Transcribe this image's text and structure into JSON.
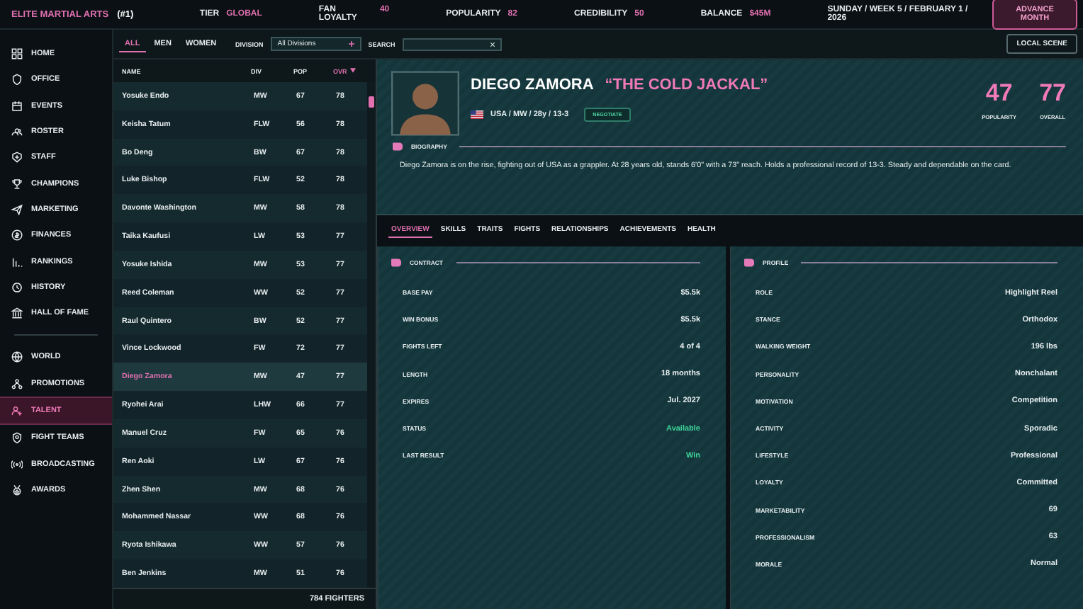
{
  "top_bar": {
    "title": "ELITE MARTIAL ARTS",
    "rank": "(#1)",
    "stats": [
      {
        "label": "TIER",
        "value": "GLOBAL"
      },
      {
        "label": "FAN LOYALTY",
        "value": "40"
      },
      {
        "label": "POPULARITY",
        "value": "82"
      },
      {
        "label": "CREDIBILITY",
        "value": "50"
      },
      {
        "label": "BALANCE",
        "value": "$45M"
      }
    ],
    "date": "SUNDAY / WEEK 5 / FEBRUARY 1 / 2026",
    "button": "ADVANCE MONTH"
  },
  "sidebar": {
    "groups": [
      [
        {
          "label": "HOME",
          "selected": false
        },
        {
          "label": "OFFICE",
          "selected": false
        },
        {
          "label": "EVENTS",
          "selected": false
        },
        {
          "label": "ROSTER",
          "selected": false
        },
        {
          "label": "STAFF",
          "selected": false
        },
        {
          "label": "CHAMPIONS",
          "selected": false
        },
        {
          "label": "MARKETING",
          "selected": false
        },
        {
          "label": "FINANCES",
          "selected": false
        },
        {
          "label": "RANKINGS",
          "selected": false
        },
        {
          "label": "HISTORY",
          "selected": false
        },
        {
          "label": "HALL OF FAME",
          "selected": false
        }
      ],
      [
        {
          "label": "WORLD",
          "selected": false
        },
        {
          "label": "PROMOTIONS",
          "selected": false
        },
        {
          "label": "TALENT",
          "selected": true
        },
        {
          "label": "FIGHT TEAMS",
          "selected": false
        },
        {
          "label": "BROADCASTING",
          "selected": false
        },
        {
          "label": "AWARDS",
          "selected": false
        }
      ]
    ]
  },
  "filters": {
    "tabs": [
      {
        "label": "ALL",
        "selected": true
      },
      {
        "label": "MEN",
        "selected": false
      },
      {
        "label": "WOMEN",
        "selected": false
      }
    ],
    "division_label": "DIVISION",
    "division_value": "All Divisions",
    "search_label": "SEARCH",
    "local_scene_button": "LOCAL SCENE"
  },
  "fighter_list": {
    "columns": [
      {
        "label": "NAME",
        "sorted": false
      },
      {
        "label": "DIV",
        "sorted": false
      },
      {
        "label": "POP",
        "sorted": false
      },
      {
        "label": "OVR",
        "sorted": true
      }
    ],
    "rows": [
      {
        "name": "Yosuke Endo",
        "division": "MW",
        "popularity": "67",
        "overall": "78",
        "selected": false
      },
      {
        "name": "Keisha Tatum",
        "division": "FLW",
        "popularity": "56",
        "overall": "78",
        "selected": false
      },
      {
        "name": "Bo Deng",
        "division": "BW",
        "popularity": "67",
        "overall": "78",
        "selected": false
      },
      {
        "name": "Luke Bishop",
        "division": "FLW",
        "popularity": "52",
        "overall": "78",
        "selected": false
      },
      {
        "name": "Davonte Washington",
        "division": "MW",
        "popularity": "58",
        "overall": "78",
        "selected": false
      },
      {
        "name": "Taika Kaufusi",
        "division": "LW",
        "popularity": "53",
        "overall": "77",
        "selected": false
      },
      {
        "name": "Yosuke Ishida",
        "division": "MW",
        "popularity": "53",
        "overall": "77",
        "selected": false
      },
      {
        "name": "Reed Coleman",
        "division": "WW",
        "popularity": "52",
        "overall": "77",
        "selected": false
      },
      {
        "name": "Raul Quintero",
        "division": "BW",
        "popularity": "52",
        "overall": "77",
        "selected": false
      },
      {
        "name": "Vince Lockwood",
        "division": "FW",
        "popularity": "72",
        "overall": "77",
        "selected": false
      },
      {
        "name": "Diego Zamora",
        "division": "MW",
        "popularity": "47",
        "overall": "77",
        "selected": true
      },
      {
        "name": "Ryohei Arai",
        "division": "LHW",
        "popularity": "66",
        "overall": "77",
        "selected": false
      },
      {
        "name": "Manuel Cruz",
        "division": "FW",
        "popularity": "65",
        "overall": "76",
        "selected": false
      },
      {
        "name": "Ren Aoki",
        "division": "LW",
        "popularity": "67",
        "overall": "76",
        "selected": false
      },
      {
        "name": "Zhen Shen",
        "division": "MW",
        "popularity": "68",
        "overall": "76",
        "selected": false
      },
      {
        "name": "Mohammed Nassar",
        "division": "WW",
        "popularity": "68",
        "overall": "76",
        "selected": false
      },
      {
        "name": "Ryota Ishikawa",
        "division": "WW",
        "popularity": "57",
        "overall": "76",
        "selected": false
      },
      {
        "name": "Ben Jenkins",
        "division": "MW",
        "popularity": "51",
        "overall": "76",
        "selected": false
      }
    ],
    "footer": "784 FIGHTERS"
  },
  "profile": {
    "name": "DIEGO ZAMORA",
    "nickname": "“THE COLD JACKAL”",
    "meta": "USA / MW / 28y / 13-3",
    "negotiate_button": "NEGOTIATE",
    "stats": [
      {
        "value": "47",
        "label": "POPULARITY"
      },
      {
        "value": "77",
        "label": "OVERALL"
      }
    ],
    "biography": {
      "title": "BIOGRAPHY",
      "text": "Diego Zamora is on the rise, fighting out of USA as a grappler. At 28 years old, stands 6'0\" with a 73\" reach. Holds a professional record of 13-3. Steady and dependable on the card."
    }
  },
  "tabs": [
    {
      "label": "OVERVIEW",
      "selected": true
    },
    {
      "label": "SKILLS",
      "selected": false
    },
    {
      "label": "TRAITS",
      "selected": false
    },
    {
      "label": "FIGHTS",
      "selected": false
    },
    {
      "label": "RELATIONSHIPS",
      "selected": false
    },
    {
      "label": "ACHIEVEMENTS",
      "selected": false
    },
    {
      "label": "HEALTH",
      "selected": false
    }
  ],
  "contract": {
    "title": "CONTRACT",
    "rows": [
      {
        "label": "BASE PAY",
        "value": "$5.5k",
        "kind": "plain"
      },
      {
        "label": "WIN BONUS",
        "value": "$5.5k",
        "kind": "plain"
      },
      {
        "label": "FIGHTS LEFT",
        "value": "4 of 4",
        "kind": "plain"
      },
      {
        "label": "LENGTH",
        "value": "18 months",
        "kind": "plain"
      },
      {
        "label": "EXPIRES",
        "value": "Jul. 2027",
        "kind": "plain"
      },
      {
        "label": "STATUS",
        "value": "Available",
        "kind": "positive"
      },
      {
        "label": "LAST RESULT",
        "value": "Win",
        "kind": "positive"
      }
    ]
  },
  "profile_panel": {
    "title": "PROFILE",
    "rows": [
      {
        "label": "ROLE",
        "value": "Highlight Reel"
      },
      {
        "label": "STANCE",
        "value": "Orthodox"
      },
      {
        "label": "WALKING WEIGHT",
        "value": "196 lbs"
      },
      {
        "label": "PERSONALITY",
        "value": "Nonchalant"
      },
      {
        "label": "MOTIVATION",
        "value": "Competition"
      },
      {
        "label": "ACTIVITY",
        "value": "Sporadic"
      },
      {
        "label": "LIFESTYLE",
        "value": "Professional"
      },
      {
        "label": "LOYALTY",
        "value": "Committed"
      },
      {
        "label": "MARKETABILITY",
        "value": "69"
      },
      {
        "label": "PROFESSIONALISM",
        "value": "63"
      },
      {
        "label": "MORALE",
        "value": "Normal"
      }
    ]
  }
}
